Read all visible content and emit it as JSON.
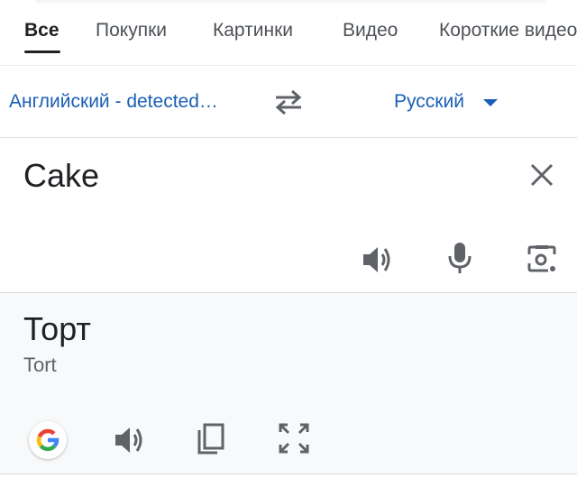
{
  "tabs": {
    "items": [
      {
        "label": "Все",
        "active": true
      },
      {
        "label": "Покупки",
        "active": false
      },
      {
        "label": "Картинки",
        "active": false
      },
      {
        "label": "Видео",
        "active": false
      },
      {
        "label": "Короткие видео",
        "active": false
      }
    ]
  },
  "language_bar": {
    "source_language": "Английский - detected…",
    "target_language": "Русский",
    "swap_icon": "swap-arrows-icon",
    "dropdown_icon": "caret-down-icon"
  },
  "source": {
    "text": "Cake",
    "icons": [
      "close-icon",
      "speaker-icon",
      "microphone-icon",
      "camera-icon"
    ]
  },
  "result": {
    "text": "Торт",
    "transliteration": "Tort",
    "icons": [
      "google-logo-icon",
      "speaker-icon",
      "copy-icon",
      "fullscreen-icon"
    ]
  },
  "colors": {
    "link_blue": "#1a5fb4",
    "icon_gray": "#5f6368",
    "result_bg": "#f8f9fa",
    "divider": "#dadce0"
  }
}
